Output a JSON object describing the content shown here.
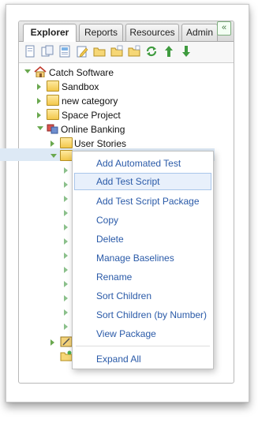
{
  "tabs": [
    {
      "label": "Explorer",
      "active": true
    },
    {
      "label": "Reports",
      "active": false
    },
    {
      "label": "Resources",
      "active": false
    },
    {
      "label": "Admin",
      "active": false
    }
  ],
  "collapse_glyph": "«",
  "toolbar_icons": [
    "new-page-icon",
    "copy-icon",
    "view-icon",
    "edit-icon",
    "folder-icon",
    "folder-add-icon",
    "folder-move-icon",
    "refresh-icon",
    "arrow-up-icon",
    "arrow-down-icon"
  ],
  "tree": {
    "root": "Catch Software",
    "nodes": [
      {
        "label": "Sandbox"
      },
      {
        "label": "new category"
      },
      {
        "label": "Space Project"
      },
      {
        "label": "Online Banking"
      },
      {
        "label": "User Stories"
      }
    ]
  },
  "context_menu": {
    "items": [
      "Add Automated Test",
      "Add Test Script",
      "Add Test Script Package",
      "Copy",
      "Delete",
      "Manage Baselines",
      "Rename",
      "Sort Children",
      "Sort Children (by Number)",
      "View Package"
    ],
    "footer": "Expand All",
    "highlighted_index": 1
  },
  "colors": {
    "menu_text": "#2a5aa8",
    "expander": "#6aa84f",
    "selection": "#dde9f5"
  }
}
